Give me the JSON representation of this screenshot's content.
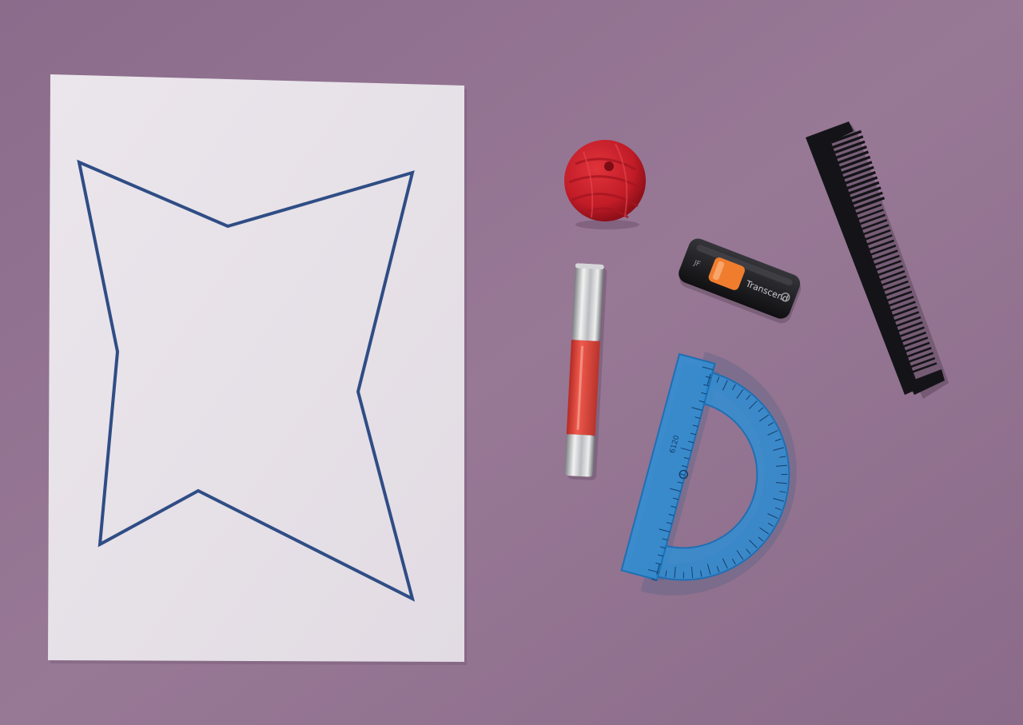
{
  "scene": {
    "background_color": "#8e6f8d",
    "objects": [
      "paper-sheet",
      "star-outline",
      "yarn-ball",
      "usb-flash-drive",
      "lipstick-crayon",
      "comb",
      "protractor-ruler"
    ]
  },
  "labels": {
    "usb_brand": "Transcend",
    "usb_slider_text": "JF",
    "ruler_brand": "6120"
  },
  "colors": {
    "paper": "#e7e1e7",
    "outline": "#2f4d85",
    "yarn": "#c41f2b",
    "usb_body": "#1c1c1f",
    "usb_slider": "#f07d2e",
    "lipstick": "#de4038",
    "comb": "#111114",
    "protractor": "#2d8fd6"
  }
}
